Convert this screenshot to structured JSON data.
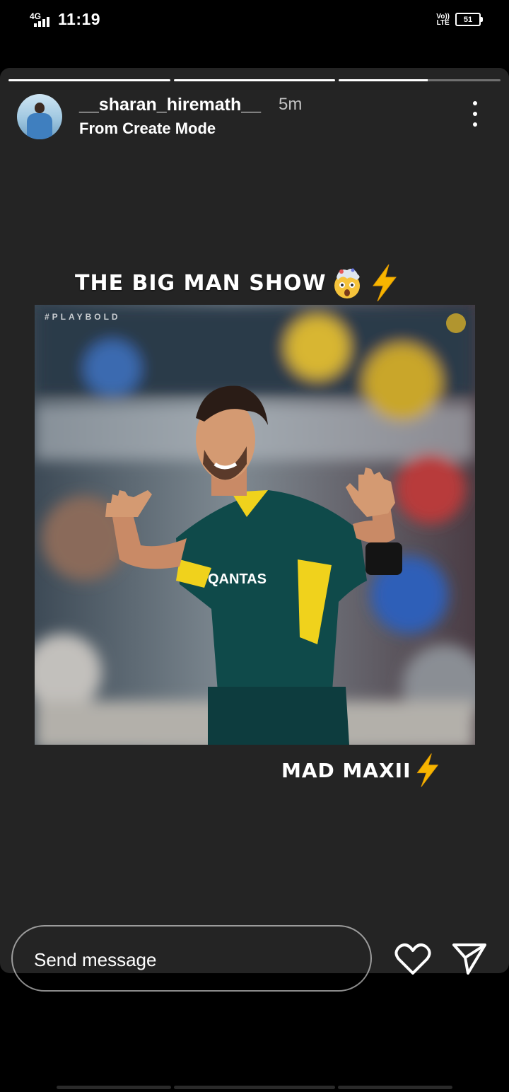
{
  "status_bar": {
    "network": "4G",
    "time": "11:19",
    "volte_top": "Vo))",
    "volte_bottom": "LTE",
    "battery": "51"
  },
  "progress": [
    1.0,
    1.0,
    0.55
  ],
  "header": {
    "username": "__sharan_hiremath__",
    "time_ago": "5m",
    "subtitle": "From Create Mode"
  },
  "story": {
    "headline": "THE BIG MAN SHOW",
    "photo_tag": "#PLAYBOLD",
    "jersey_text": "QANTAS",
    "caption": "MAD MAXII"
  },
  "reply_bar": {
    "placeholder": "Send message"
  },
  "icons": {
    "more": "more-vertical-icon",
    "like": "heart-icon",
    "send": "send-icon",
    "headline_emoji": "exploding-head-emoji",
    "bolt": "high-voltage-emoji"
  },
  "colors": {
    "background": "#000000",
    "card": "#242424",
    "bolt": "#f7b500",
    "jersey": "#0f4a4a",
    "jersey_accent": "#f0d21c"
  }
}
